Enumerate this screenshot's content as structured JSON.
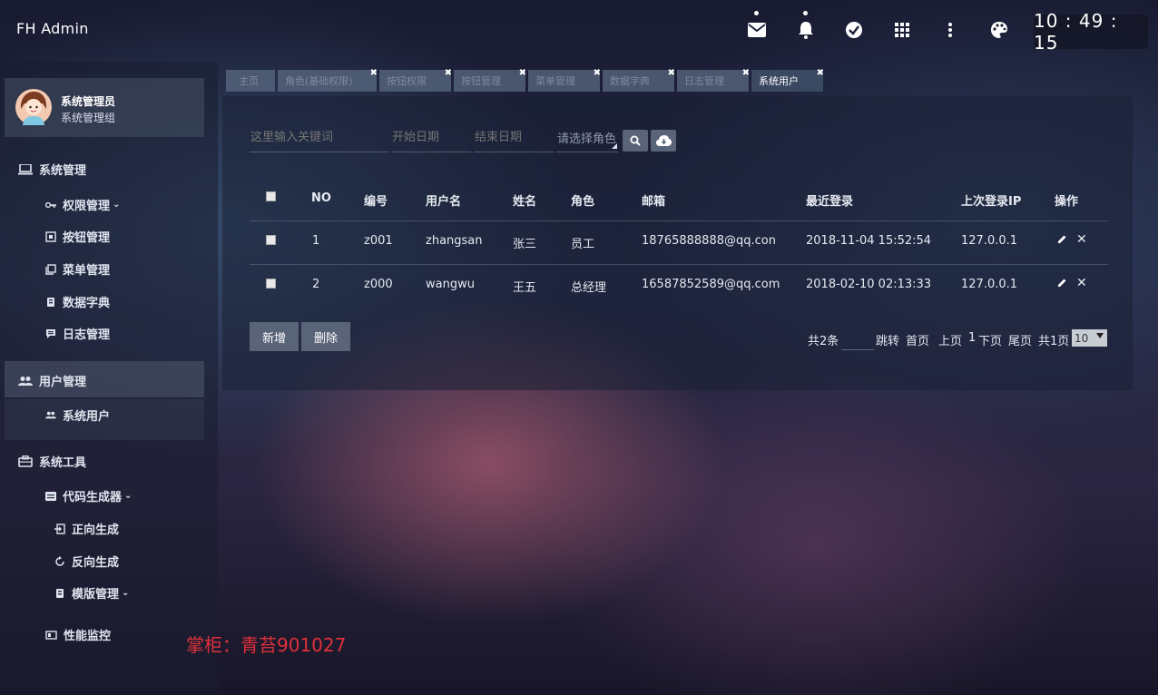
{
  "header": {
    "brand": "FH Admin",
    "clock": "10 : 49 : 15",
    "icons": [
      "mail-icon",
      "bell-icon",
      "check-circle-icon",
      "apps-grid-icon",
      "more-vert-icon",
      "palette-icon"
    ]
  },
  "sidebar": {
    "user_name": "系统管理员",
    "user_group": "系统管理组",
    "items": [
      {
        "label": "系统管理",
        "icon": "laptop-icon"
      },
      {
        "label": "权限管理",
        "icon": "key-icon"
      },
      {
        "label": "按钮管理",
        "icon": "button-icon"
      },
      {
        "label": "菜单管理",
        "icon": "menu-icon"
      },
      {
        "label": "数据字典",
        "icon": "book-icon"
      },
      {
        "label": "日志管理",
        "icon": "log-icon"
      },
      {
        "label": "用户管理",
        "icon": "users-icon"
      },
      {
        "label": "系统用户",
        "icon": "users-icon"
      },
      {
        "label": "系统工具",
        "icon": "briefcase-icon"
      },
      {
        "label": "代码生成器",
        "icon": "code-icon"
      },
      {
        "label": "正向生成",
        "icon": "import-icon"
      },
      {
        "label": "反向生成",
        "icon": "refresh-icon"
      },
      {
        "label": "模版管理",
        "icon": "template-icon"
      },
      {
        "label": "性能监控",
        "icon": "monitor-icon"
      }
    ]
  },
  "tabs": [
    {
      "label": "主页",
      "closable": false
    },
    {
      "label": "角色(基础权限)",
      "closable": true
    },
    {
      "label": "按钮权限",
      "closable": true
    },
    {
      "label": "按钮管理",
      "closable": true
    },
    {
      "label": "菜单管理",
      "closable": true
    },
    {
      "label": "数据字典",
      "closable": true
    },
    {
      "label": "日志管理",
      "closable": true
    },
    {
      "label": "系统用户",
      "closable": true,
      "active": true
    }
  ],
  "search": {
    "keyword_placeholder": "这里输入关键词",
    "start_date_placeholder": "开始日期",
    "end_date_placeholder": "结束日期",
    "role_select": "请选择角色"
  },
  "table": {
    "headers": [
      "NO",
      "编号",
      "用户名",
      "姓名",
      "角色",
      "邮箱",
      "最近登录",
      "上次登录IP",
      "操作"
    ],
    "rows": [
      {
        "no": "1",
        "code": "z001",
        "username": "zhangsan",
        "name": "张三",
        "role": "员工",
        "email": "18765888888@qq.con",
        "last_login": "2018-11-04 15:52:54",
        "ip": "127.0.0.1"
      },
      {
        "no": "2",
        "code": "z000",
        "username": "wangwu",
        "name": "王五",
        "role": "总经理",
        "email": "16587852589@qq.com",
        "last_login": "2018-02-10 02:13:33",
        "ip": "127.0.0.1"
      }
    ]
  },
  "actions": {
    "add": "新增",
    "delete": "删除"
  },
  "pager": {
    "total": "共2条",
    "jump": "跳转",
    "first": "首页",
    "prev": "上页",
    "current": "1",
    "next": "下页",
    "last": "尾页",
    "pages": "共1页",
    "page_size": "10"
  },
  "watermark": "掌柜：青苔901027"
}
